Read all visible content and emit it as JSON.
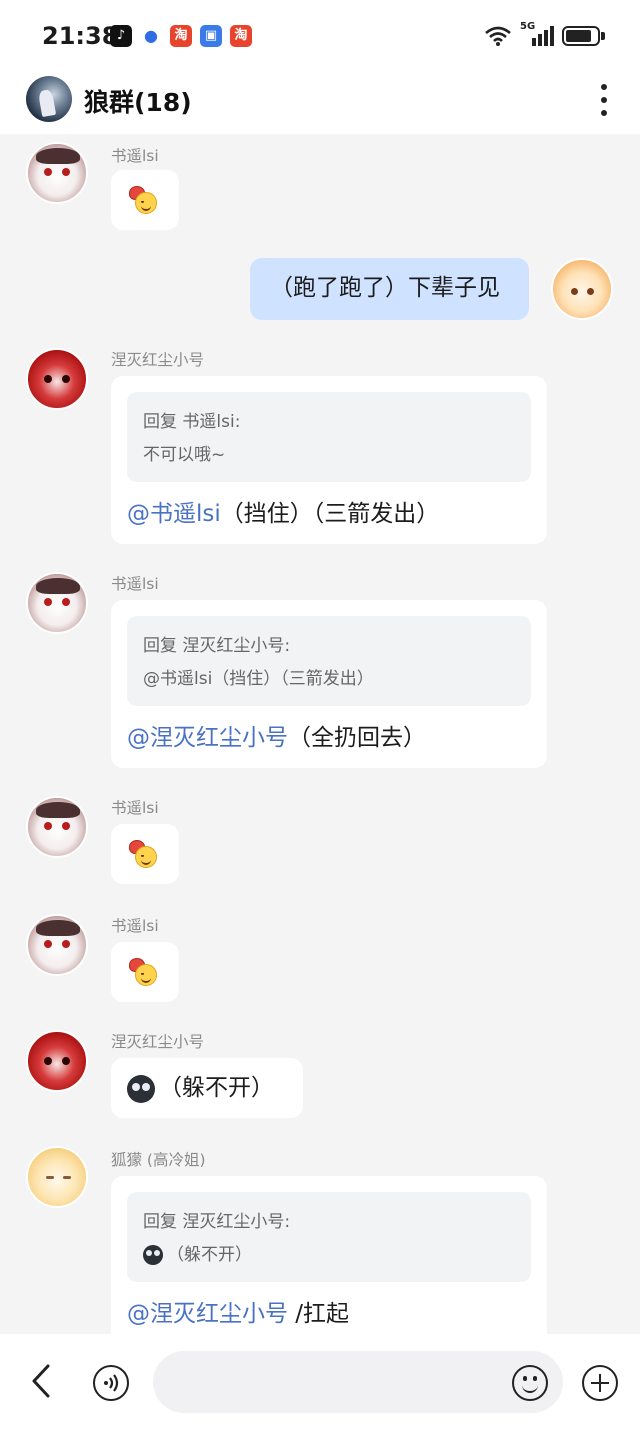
{
  "status_bar": {
    "time": "21:38",
    "app_icons": [
      {
        "name": "tiktok-icon",
        "glyph": "♪",
        "color": "#111111"
      },
      {
        "name": "baidu-icon",
        "glyph": "🐾",
        "color": "#2f6ce5"
      },
      {
        "name": "taobao-icon",
        "glyph": "淘",
        "color": "#e8432c"
      },
      {
        "name": "app-box-icon",
        "glyph": "▣",
        "color": "#3b7be8"
      },
      {
        "name": "taobao-special-icon",
        "glyph": "淘",
        "color": "#e8432c"
      }
    ],
    "network": "5G",
    "battery_level": 0.85
  },
  "header": {
    "title": "狼群(18)"
  },
  "messages": [
    {
      "sender": "书遥lsi",
      "type": "emoji"
    },
    {
      "sender": "self",
      "text": "（跑了跑了）下辈子见"
    },
    {
      "sender": "涅灭红尘小号",
      "quote_title": "回复 书遥lsi:",
      "quote_text": "不可以哦~",
      "mention": "@书遥lsi",
      "text": "（挡住）（三箭发出）"
    },
    {
      "sender": "书遥lsi",
      "quote_title": "回复 涅灭红尘小号:",
      "quote_text": "@书遥lsi（挡住）（三箭发出）",
      "mention": "@涅灭红尘小号",
      "text": "（全扔回去）"
    },
    {
      "sender": "书遥lsi",
      "type": "emoji"
    },
    {
      "sender": "书遥lsi",
      "type": "emoji"
    },
    {
      "sender": "涅灭红尘小号",
      "text": "（躲不开）"
    },
    {
      "sender": "狐獴 (高冷姐)",
      "quote_title": "回复 涅灭红尘小号:",
      "quote_text": "（躲不开）",
      "mention": "@涅灭红尘小号",
      "text": " /扛起"
    }
  ],
  "input_bar": {
    "placeholder": ""
  }
}
